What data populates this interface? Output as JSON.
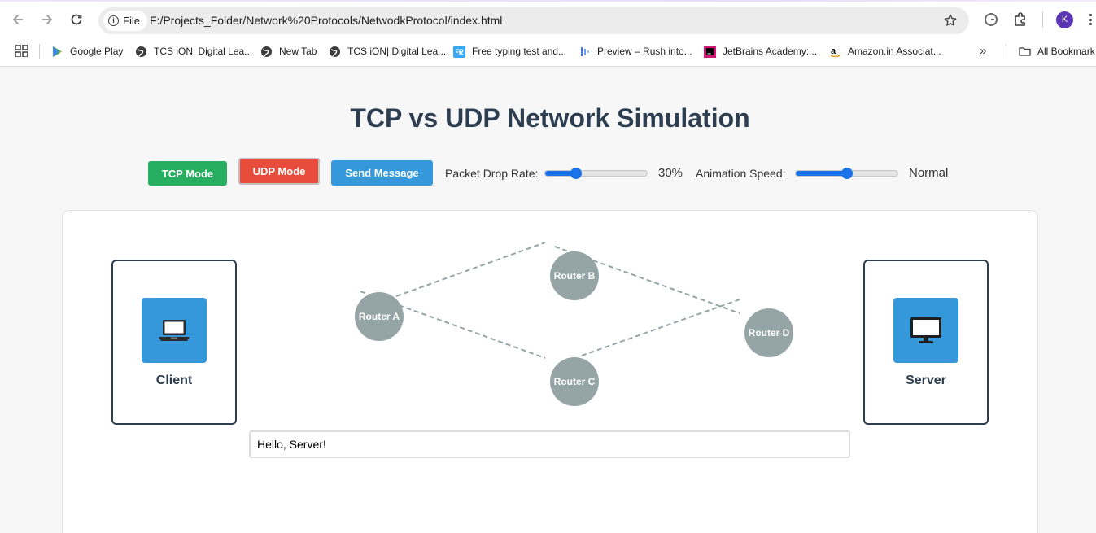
{
  "browser": {
    "file_chip": "File",
    "url": "F:/Projects_Folder/Network%20Protocols/NetwodkProtocol/index.html",
    "profile_initial": "K",
    "bookmarks": [
      {
        "label": "Google Play",
        "icon": "google-play-icon"
      },
      {
        "label": "TCS iON| Digital Lea...",
        "icon": "globe-icon"
      },
      {
        "label": "New Tab",
        "icon": "globe-icon"
      },
      {
        "label": "TCS iON| Digital Lea...",
        "icon": "globe-icon"
      },
      {
        "label": "Free typing test and...",
        "icon": "typing-icon"
      },
      {
        "label": "Preview – Rush into...",
        "icon": "preview-icon"
      },
      {
        "label": "JetBrains Academy:...",
        "icon": "jetbrains-icon"
      },
      {
        "label": "Amazon.in Associat...",
        "icon": "amazon-icon"
      }
    ],
    "all_bookmarks": "All Bookmark"
  },
  "page": {
    "title": "TCP vs UDP Network Simulation",
    "controls": {
      "tcp_button": "TCP Mode",
      "udp_button": "UDP Mode",
      "send_button": "Send Message",
      "drop_label": "Packet Drop Rate:",
      "drop_value": "30%",
      "drop_fraction": 0.3,
      "speed_label": "Animation Speed:",
      "speed_value": "Normal",
      "speed_fraction": 0.5
    },
    "network": {
      "client_label": "Client",
      "server_label": "Server",
      "routers": [
        "Router A",
        "Router B",
        "Router C",
        "Router D"
      ]
    },
    "message_input_value": "Hello, Server!"
  },
  "colors": {
    "tcp": "#27ae60",
    "udp": "#e74c3c",
    "send": "#3498db",
    "router": "#95a5a6",
    "title": "#2c3e50"
  }
}
